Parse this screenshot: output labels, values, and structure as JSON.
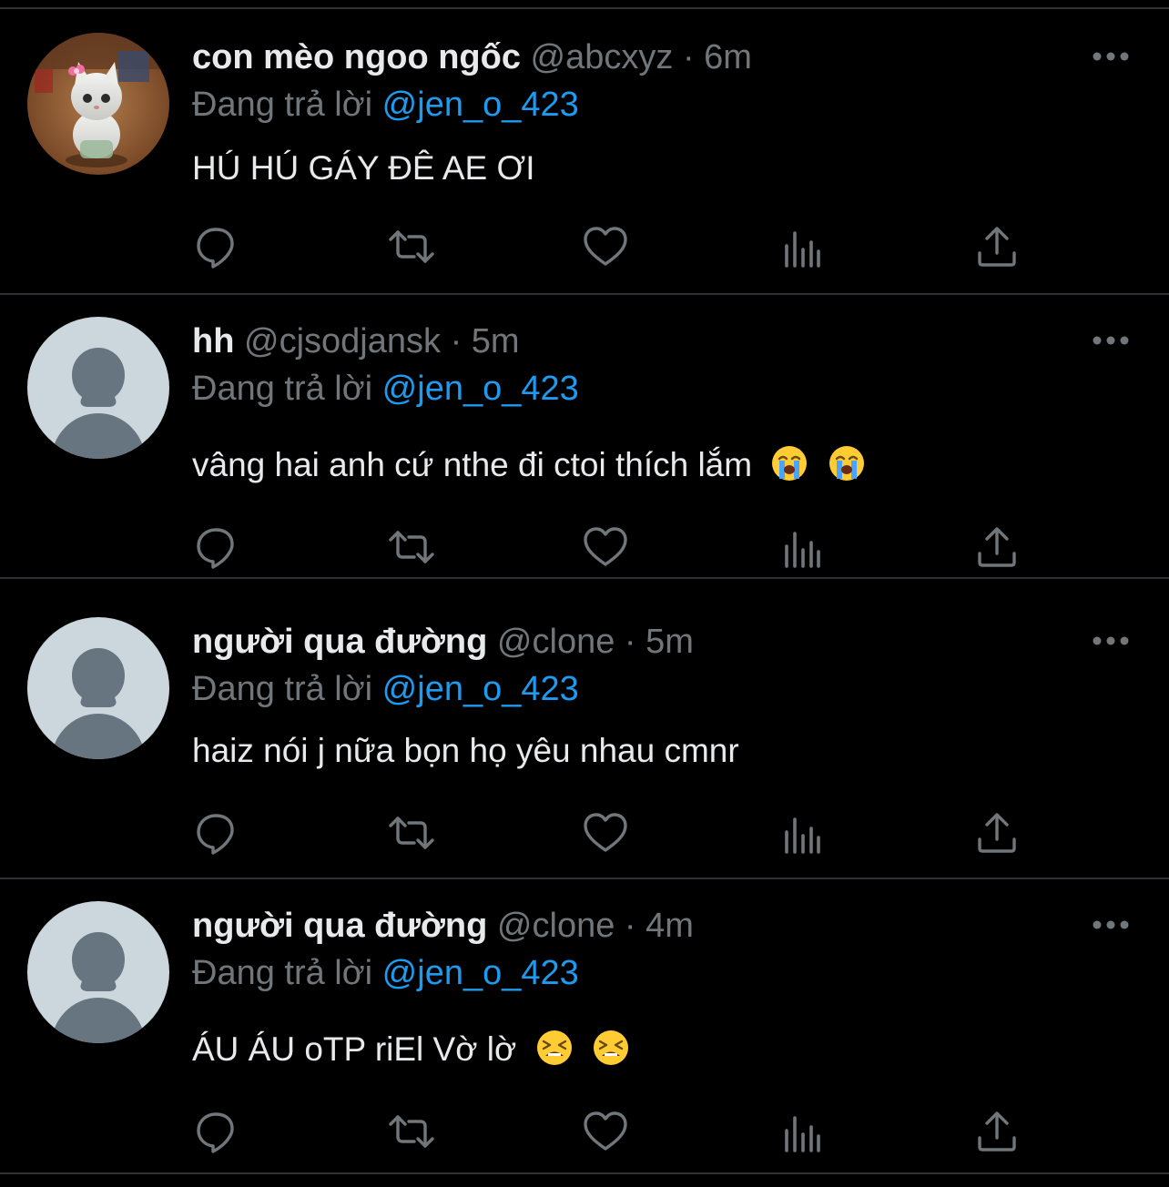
{
  "tweets": [
    {
      "name": "con mèo ngoo ngốc",
      "handle": "@abcxyz",
      "separator": "·",
      "time": "6m",
      "reply_prefix": "Đang trả lời",
      "reply_to": "@jen_o_423",
      "text": "HÚ HÚ GÁY ĐÊ AE ƠI",
      "avatar": "cat-figurine-photo",
      "emojis": []
    },
    {
      "name": "hh",
      "handle": "@cjsodjansk",
      "separator": "·",
      "time": "5m",
      "reply_prefix": "Đang trả lời",
      "reply_to": "@jen_o_423",
      "text": "vâng hai anh cứ nthe đi ctoi thích lắm",
      "avatar": "default-avatar",
      "emojis": [
        "loudly-crying-face",
        "loudly-crying-face"
      ]
    },
    {
      "name": "người qua đường",
      "handle": "@clone",
      "separator": "·",
      "time": "5m",
      "reply_prefix": "Đang trả lời",
      "reply_to": "@jen_o_423",
      "text": "haiz nói j nữa bọn họ yêu nhau cmnr",
      "avatar": "default-avatar",
      "emojis": []
    },
    {
      "name": "người qua đường",
      "handle": "@clone",
      "separator": "·",
      "time": "4m",
      "reply_prefix": "Đang trả lời",
      "reply_to": "@jen_o_423",
      "text": "ÁU ÁU oTP riEl Vờ lờ",
      "avatar": "default-avatar",
      "emojis": [
        "tired-face",
        "tired-face"
      ]
    }
  ],
  "actions": [
    "reply-icon",
    "retweet-icon",
    "like-icon",
    "views-icon",
    "share-icon"
  ],
  "colors": {
    "background": "#000000",
    "divider": "#2f3336",
    "primary_text": "#e7e9ea",
    "secondary_text": "#71767b",
    "accent": "#1d9bf0",
    "default_avatar_bg": "#ccd6dd",
    "default_avatar_fg": "#66757f"
  }
}
